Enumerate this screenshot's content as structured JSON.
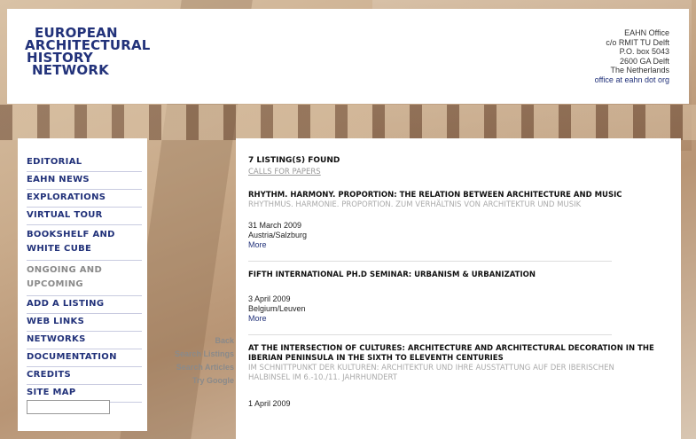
{
  "header": {
    "logo_lines": [
      "EUROPEAN",
      "ARCHITECTURAL",
      "HISTORY",
      "NETWORK"
    ],
    "office_lines": [
      "EAHN Office",
      "c/o RMIT TU Delft",
      "P.O. box 5043",
      "2600 GA Delft",
      "The Netherlands"
    ],
    "office_email": "office at eahn dot org"
  },
  "nav": [
    {
      "label": "EDITORIAL"
    },
    {
      "label": "EAHN NEWS"
    },
    {
      "label": "EXPLORATIONS"
    },
    {
      "label": "VIRTUAL TOUR"
    },
    {
      "label": "BOOKSHELF AND WHITE CUBE"
    },
    {
      "label": "ONGOING AND UPCOMING"
    },
    {
      "label": "ADD A LISTING"
    },
    {
      "label": "WEB LINKS"
    },
    {
      "label": "NETWORKS"
    },
    {
      "label": "DOCUMENTATION"
    },
    {
      "label": "CREDITS"
    },
    {
      "label": "SITE MAP"
    }
  ],
  "tools": {
    "back": "Back",
    "search_listings": "Search Listings",
    "search_articles": "Search Articles",
    "try_google": "Try Google"
  },
  "content": {
    "found": "7 LISTING(S) FOUND",
    "category": "CALLS FOR PAPERS",
    "listings": [
      {
        "title": "RHYTHM. HARMONY. PROPORTION: THE RELATION BETWEEN ARCHITECTURE AND MUSIC",
        "subtitle": "RHYTHMUS. HARMONIE. PROPORTION. ZUM VERHÄLTNIS VON ARCHITEKTUR UND MUSIK",
        "date": "31 March 2009",
        "place": "Austria/Salzburg",
        "more": "More"
      },
      {
        "title": "FIFTH INTERNATIONAL PH.D SEMINAR: URBANISM & URBANIZATION",
        "subtitle": "",
        "date": "3 April 2009",
        "place": "Belgium/Leuven",
        "more": "More"
      },
      {
        "title": "AT THE INTERSECTION OF CULTURES: ARCHITECTURE AND ARCHITECTURAL DECORATION IN THE IBERIAN PENINSULA IN THE SIXTH TO ELEVENTH CENTURIES",
        "subtitle": "IM SCHNITTPUNKT DER KULTUREN: ARCHITEKTUR UND IHRE AUSSTATTUNG AUF DER IBERISCHEN HALBINSEL IM 6.-10./11. JAHRHUNDERT",
        "date": "1 April 2009",
        "place": "",
        "more": ""
      }
    ]
  }
}
